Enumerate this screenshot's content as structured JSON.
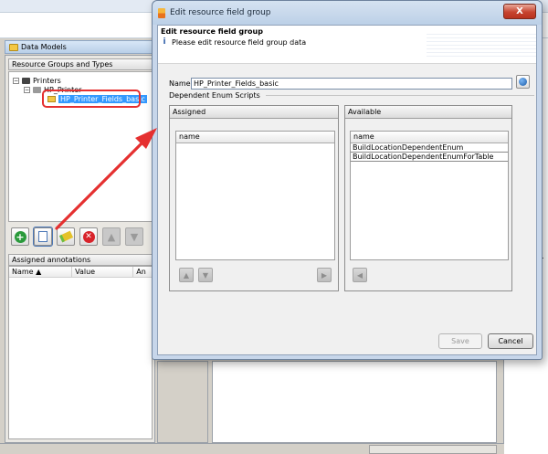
{
  "background": {
    "panel_title": "Data Models",
    "groups_title": "Resource Groups and Types",
    "tree": {
      "root": "Printers",
      "child": "HP_Printer",
      "selected": "HP_Printer_Fields_basic"
    },
    "annotations_title": "Assigned annotations",
    "annotation_columns": [
      "Name",
      "Value",
      "An"
    ]
  },
  "dialog": {
    "title": "Edit resource field group",
    "close_label": "X",
    "banner_title": "Edit resource field group",
    "banner_subtitle": "Please edit resource field group data",
    "name_label": "Name:",
    "name_value": "HP_Printer_Fields_basic",
    "dependent_label": "Dependent Enum Scripts",
    "assigned": {
      "title": "Assigned",
      "column": "name",
      "rows": []
    },
    "available": {
      "title": "Available",
      "column": "name",
      "rows": [
        "BuildLocationDependentEnum",
        "BuildLocationDependentEnumForTable"
      ]
    },
    "save_label": "Save",
    "cancel_label": "Cancel"
  },
  "colors": {
    "annotation_red": "#e53030",
    "selection_blue": "#3399ff",
    "titlebar": "#c7d6ea"
  }
}
